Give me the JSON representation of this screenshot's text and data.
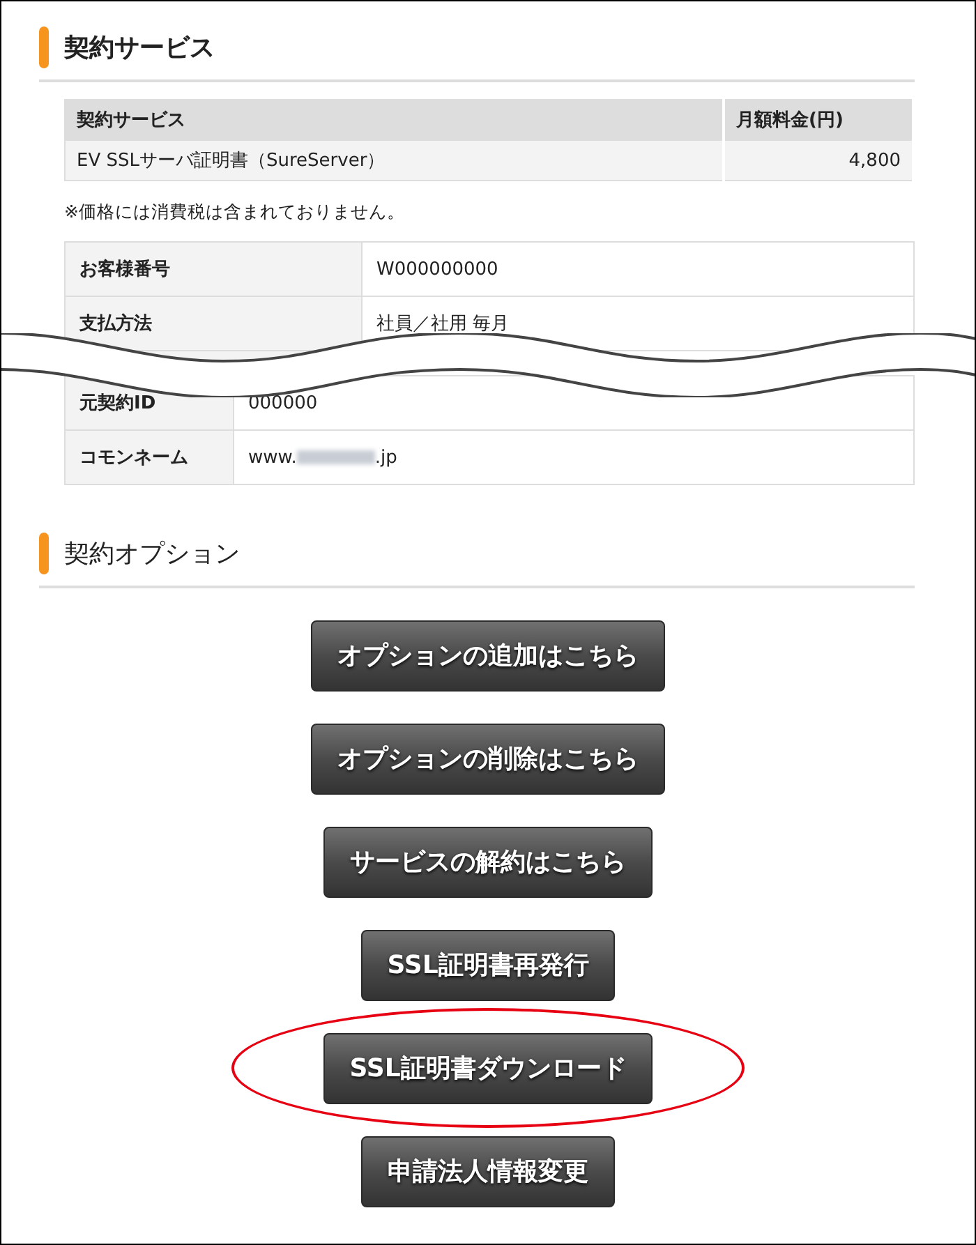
{
  "service_section": {
    "title": "契約サービス",
    "table": {
      "columns": [
        "契約サービス",
        "月額料金(円)"
      ],
      "rows": [
        {
          "service": "EV SSLサーバ証明書（SureServer）",
          "price": "4,800"
        }
      ]
    },
    "note": "※価格には消費税は含まれておりません。",
    "details_upper": [
      {
        "label": "お客様番号",
        "value": "W000000000"
      },
      {
        "label": "支払方法",
        "value": "社員／社用 毎月"
      }
    ],
    "details_lower": [
      {
        "label": "元契約ID",
        "value": "000000",
        "blurred": false
      },
      {
        "label": "コモンネーム",
        "value": "www.",
        "suffix": ".jp",
        "blurred": true
      }
    ]
  },
  "option_section": {
    "title": "契約オプション",
    "buttons": [
      {
        "label": "オプションの追加はこちら",
        "highlighted": false
      },
      {
        "label": "オプションの削除はこちら",
        "highlighted": false
      },
      {
        "label": "サービスの解約はこちら",
        "highlighted": false
      },
      {
        "label": "SSL証明書再発行",
        "highlighted": false
      },
      {
        "label": "SSL証明書ダウンロード",
        "highlighted": true
      },
      {
        "label": "申請法人情報変更",
        "highlighted": false
      }
    ]
  }
}
